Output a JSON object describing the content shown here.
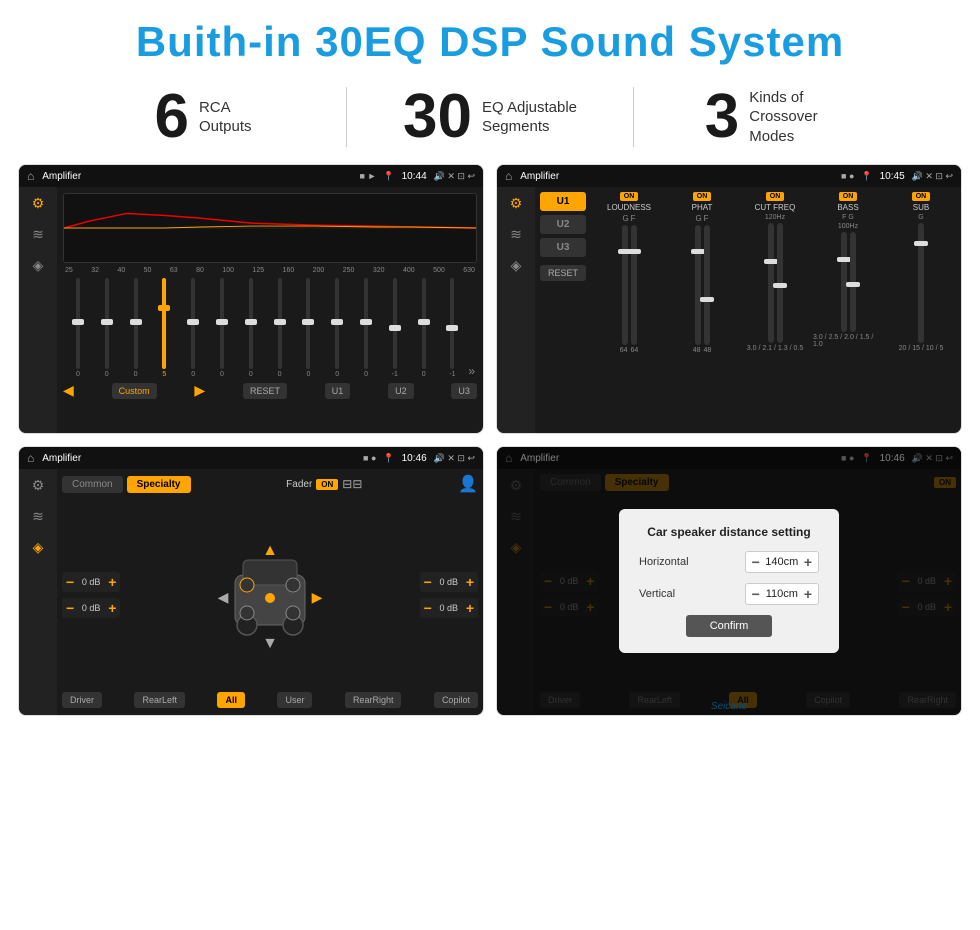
{
  "header": {
    "title": "Buith-in 30EQ DSP Sound System"
  },
  "stats": [
    {
      "number": "6",
      "label": "RCA\nOutputs"
    },
    {
      "number": "30",
      "label": "EQ Adjustable\nSegments"
    },
    {
      "number": "3",
      "label": "Kinds of\nCrossover Modes"
    }
  ],
  "screens": {
    "screen1": {
      "title": "Amplifier",
      "time": "10:44",
      "freqs": [
        "25",
        "32",
        "40",
        "50",
        "63",
        "80",
        "100",
        "125",
        "160",
        "200",
        "250",
        "320",
        "400",
        "500",
        "630"
      ],
      "sliders": [
        0,
        0,
        0,
        5,
        0,
        0,
        0,
        0,
        0,
        0,
        0,
        -1,
        0,
        -1
      ],
      "modes": [
        "Custom",
        "RESET",
        "U1",
        "U2",
        "U3"
      ],
      "expand_icon": ">>"
    },
    "screen2": {
      "title": "Amplifier",
      "time": "10:45",
      "u_buttons": [
        "U1",
        "U2",
        "U3"
      ],
      "channels": [
        {
          "label": "LOUDNESS",
          "on": true
        },
        {
          "label": "PHAT",
          "on": true
        },
        {
          "label": "CUT FREQ",
          "on": true
        },
        {
          "label": "BASS",
          "on": true
        },
        {
          "label": "SUB",
          "on": true
        }
      ],
      "reset_label": "RESET"
    },
    "screen3": {
      "title": "Amplifier",
      "time": "10:46",
      "tabs": [
        "Common",
        "Specialty"
      ],
      "fader_label": "Fader",
      "on_badge": "ON",
      "positions": {
        "top_left": "0 dB",
        "top_right": "0 dB",
        "bot_left": "0 dB",
        "bot_right": "0 dB"
      },
      "buttons": {
        "driver": "Driver",
        "rear_left": "RearLeft",
        "all": "All",
        "user": "User",
        "rear_right": "RearRight",
        "copilot": "Copilot"
      }
    },
    "screen4": {
      "title": "Amplifier",
      "time": "10:46",
      "tabs": [
        "Common",
        "Specialty"
      ],
      "dialog": {
        "title": "Car speaker distance setting",
        "rows": [
          {
            "label": "Horizontal",
            "value": "140cm"
          },
          {
            "label": "Vertical",
            "value": "110cm"
          }
        ],
        "confirm_label": "Confirm"
      },
      "positions": {
        "top_right": "0 dB",
        "bot_right": "0 dB"
      },
      "buttons": {
        "driver": "Driver",
        "rear_left": "RearLeft",
        "copilot": "Copilot",
        "rear_right": "RearRight"
      },
      "watermark": "Seicane"
    }
  }
}
